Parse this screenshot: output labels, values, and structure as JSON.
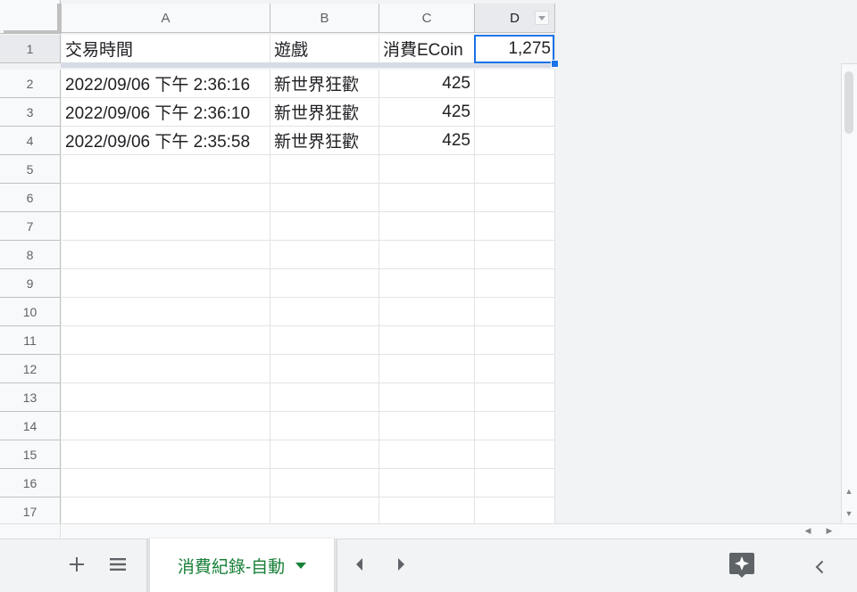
{
  "columns": [
    "A",
    "B",
    "C",
    "D"
  ],
  "rows": [
    "1",
    "2",
    "3",
    "4",
    "5",
    "6",
    "7",
    "8",
    "9",
    "10",
    "11",
    "12",
    "13",
    "14",
    "15",
    "16",
    "17"
  ],
  "cells": {
    "r1": {
      "a": "交易時間",
      "b": "遊戲",
      "c": "消費ECoin",
      "d": "1,275"
    },
    "r2": {
      "a": "2022/09/06 下午 2:36:16",
      "b": "新世界狂歡",
      "c": "425"
    },
    "r3": {
      "a": "2022/09/06 下午 2:36:10",
      "b": "新世界狂歡",
      "c": "425"
    },
    "r4": {
      "a": "2022/09/06 下午 2:35:58",
      "b": "新世界狂歡",
      "c": "425"
    }
  },
  "selected_cell": "D1",
  "sheet_tab": {
    "label": "消費紀錄-自動"
  },
  "icons": {
    "add_sheet": "plus-icon",
    "all_sheets": "list-icon",
    "tab_menu": "caret-down-icon",
    "scroll_tabs_left": "chevron-left-icon",
    "scroll_tabs_right": "chevron-right-icon",
    "explore": "explore-sparkle-icon",
    "collapse_panel": "chevron-left-icon"
  },
  "colors": {
    "accent": "#1a73e8",
    "tab_text": "#188038"
  }
}
